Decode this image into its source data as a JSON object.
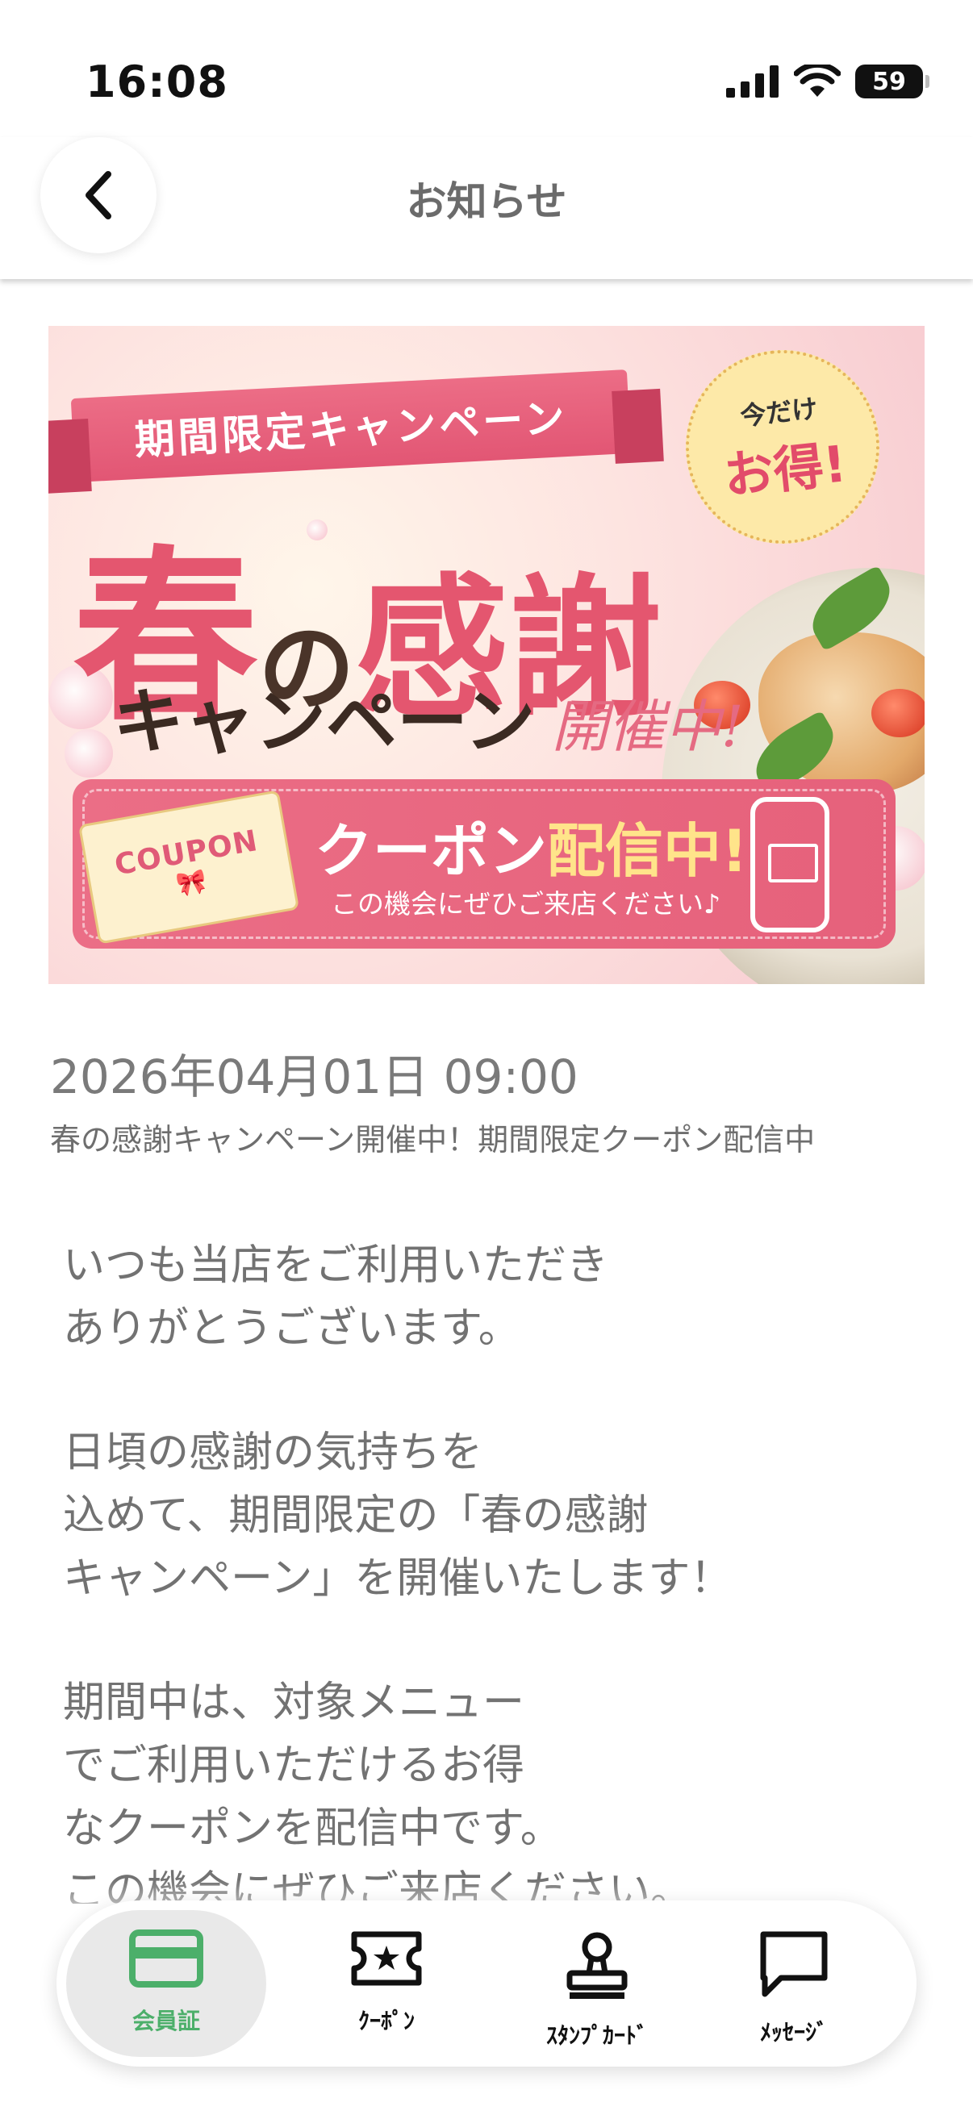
{
  "status_bar": {
    "time": "16:08",
    "battery": "59"
  },
  "header": {
    "title": "お知らせ",
    "back_icon": "chevron-left-icon"
  },
  "banner": {
    "ribbon": "期間限定キャンペーン",
    "badge_small": "今だけ",
    "badge_big": "お得!",
    "title_part1": "春",
    "title_part2": "の",
    "title_part3": "感謝",
    "campaign_word": "キャンペーン",
    "campaign_open": "開催中!",
    "coupon_ticket": "COUPON",
    "coupon_headline_white": "クーポン",
    "coupon_headline_yellow": "配信中!",
    "coupon_sub": "この機会にぜひご来店ください♪"
  },
  "article": {
    "date": "2026年04月01日 09:00",
    "subtitle": "春の感謝キャンペーン開催中！期間限定クーポン配信中",
    "paragraphs": [
      "いつも当店をご利用いただき\nありがとうございます。",
      "日頃の感謝の気持ちを\n込めて、期間限定の「春の感謝\nキャンペーン」を開催いたします！",
      "期間中は、対象メニュー\nでご利用いただけるお得\nなクーポンを配信中です。\nこの機会にぜひご来店ください。"
    ]
  },
  "tabbar": {
    "accent_color": "#4caf6a",
    "items": [
      {
        "label": "会員証",
        "icon": "membership-card-icon",
        "active": true
      },
      {
        "label": "ｸｰﾎﾟﾝ",
        "icon": "coupon-ticket-icon",
        "active": false
      },
      {
        "label": "ｽﾀﾝﾌﾟｶｰﾄﾞ",
        "icon": "stamp-icon",
        "active": false
      },
      {
        "label": "ﾒｯｾｰｼﾞ",
        "icon": "message-bubble-icon",
        "active": false
      }
    ]
  }
}
